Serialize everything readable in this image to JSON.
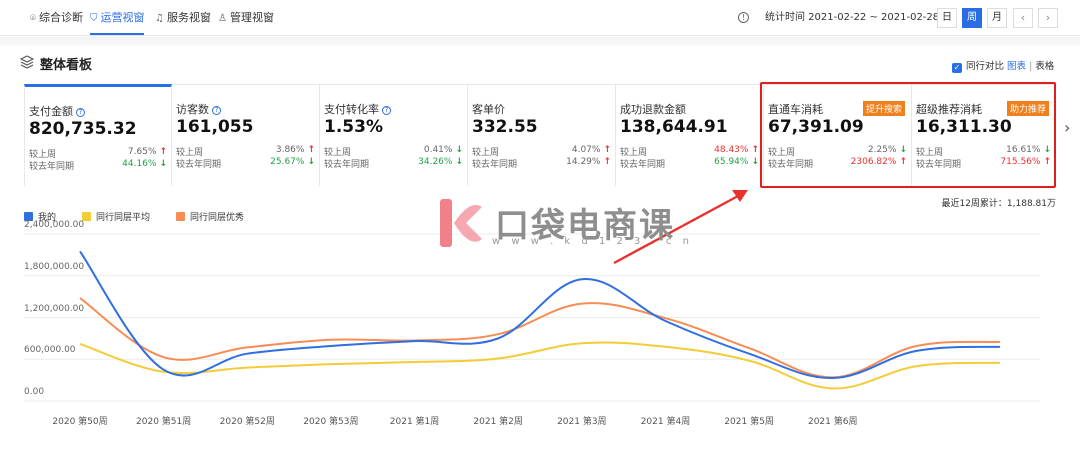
{
  "topnav": {
    "tabs": [
      {
        "label": "综合诊断",
        "icon": "location-pin-icon"
      },
      {
        "label": "运营视窗",
        "icon": "shield-icon"
      },
      {
        "label": "服务视窗",
        "icon": "headset-icon"
      },
      {
        "label": "管理视窗",
        "icon": "user-icon"
      }
    ],
    "active_tab": "运营视窗",
    "date_range": "统计时间 2021-02-22 ~ 2021-02-28",
    "periods": [
      "日",
      "周",
      "月"
    ],
    "active_period": "周",
    "prev": "‹",
    "next": "›",
    "info": "!"
  },
  "panel": {
    "title": "整体看板",
    "compare_label": "同行对比",
    "chart_link": "图表",
    "separator": "|",
    "table_link": "表格"
  },
  "cards": [
    {
      "label": "支付金额",
      "value": "820,735.32",
      "help": "?",
      "wow_label": "较上周",
      "wow": "7.65%",
      "wow_dir": "up",
      "yoy_label": "较去年同期",
      "yoy": "44.16%",
      "yoy_dir": "down"
    },
    {
      "label": "访客数",
      "value": "161,055",
      "help": "?",
      "wow_label": "较上周",
      "wow": "3.86%",
      "wow_dir": "up",
      "yoy_label": "较去年同期",
      "yoy": "25.67%",
      "yoy_dir": "down"
    },
    {
      "label": "支付转化率",
      "value": "1.53%",
      "help": "?",
      "wow_label": "较上周",
      "wow": "0.41%",
      "wow_dir": "down",
      "yoy_label": "较去年同期",
      "yoy": "34.26%",
      "yoy_dir": "down"
    },
    {
      "label": "客单价",
      "value": "332.55",
      "help": "",
      "wow_label": "较上周",
      "wow": "4.07%",
      "wow_dir": "up",
      "yoy_label": "较去年同期",
      "yoy": "14.29%",
      "yoy_dir": "up"
    },
    {
      "label": "成功退款金额",
      "value": "138,644.91",
      "help": "",
      "wow_label": "较上周",
      "wow": "48.43%",
      "wow_dir": "up",
      "yoy_label": "较去年同期",
      "yoy": "65.94%",
      "yoy_dir": "down"
    },
    {
      "label": "直通车消耗",
      "value": "67,391.09",
      "help": "",
      "tag": "提升搜索",
      "wow_label": "较上周",
      "wow": "2.25%",
      "wow_dir": "down",
      "yoy_label": "较去年同期",
      "yoy": "2306.82%",
      "yoy_dir": "up"
    },
    {
      "label": "超级推荐消耗",
      "value": "16,311.30",
      "help": "",
      "tag": "助力推荐",
      "wow_label": "较上周",
      "wow": "16.61%",
      "wow_dir": "down",
      "yoy_label": "较去年同期",
      "yoy": "715.56%",
      "yoy_dir": "up"
    }
  ],
  "arrows": {
    "up": "🠕",
    "down": "🠗",
    "next_card": "›"
  },
  "watermark": {
    "title": "口袋电商课",
    "url": "w w w . k d 1 2 3 . c n"
  },
  "total_label": "最近12周累计：1,188.81万",
  "chart_data": {
    "type": "line",
    "categories": [
      "2020 第50周",
      "2020 第51周",
      "2020 第52周",
      "2020 第53周",
      "2021 第1周",
      "2021 第2周",
      "2021 第3周",
      "2021 第4周",
      "2021 第5周",
      "2021 第6周",
      "",
      ""
    ],
    "yticks": [
      "2,400,000.00",
      "1,800,000.00",
      "1,200,000.00",
      "600,000.00",
      "0.00"
    ],
    "ylim": [
      0,
      2400000
    ],
    "grid": true,
    "legend_position": "top-left",
    "series": [
      {
        "name": "我的",
        "color": "#2f6fe0",
        "values": [
          2150000,
          450000,
          680000,
          790000,
          860000,
          900000,
          1750000,
          1150000,
          680000,
          330000,
          720000,
          780000
        ]
      },
      {
        "name": "同行同层平均",
        "color": "#f4cc37",
        "values": [
          820000,
          420000,
          480000,
          530000,
          560000,
          610000,
          830000,
          780000,
          580000,
          180000,
          500000,
          550000
        ]
      },
      {
        "name": "同行同层优秀",
        "color": "#f78c54",
        "values": [
          1480000,
          630000,
          770000,
          880000,
          870000,
          960000,
          1400000,
          1190000,
          760000,
          340000,
          790000,
          850000
        ]
      }
    ]
  }
}
